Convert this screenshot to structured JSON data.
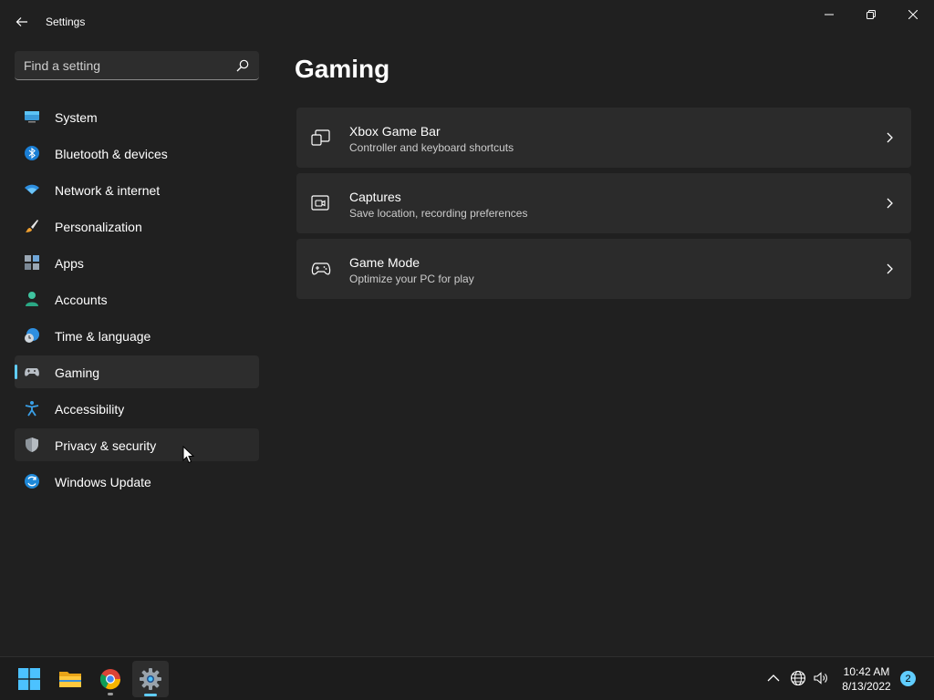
{
  "window": {
    "title": "Settings"
  },
  "search": {
    "placeholder": "Find a setting"
  },
  "sidebar": {
    "items": [
      {
        "label": "System",
        "icon": "monitor-icon"
      },
      {
        "label": "Bluetooth & devices",
        "icon": "bluetooth-icon"
      },
      {
        "label": "Network & internet",
        "icon": "wifi-icon"
      },
      {
        "label": "Personalization",
        "icon": "brush-icon"
      },
      {
        "label": "Apps",
        "icon": "apps-icon"
      },
      {
        "label": "Accounts",
        "icon": "person-icon"
      },
      {
        "label": "Time & language",
        "icon": "clock-globe-icon"
      },
      {
        "label": "Gaming",
        "icon": "gamepad-icon",
        "selected": true
      },
      {
        "label": "Accessibility",
        "icon": "accessibility-icon"
      },
      {
        "label": "Privacy & security",
        "icon": "shield-icon",
        "hovered": true
      },
      {
        "label": "Windows Update",
        "icon": "update-icon"
      }
    ]
  },
  "main": {
    "title": "Gaming",
    "cards": [
      {
        "title": "Xbox Game Bar",
        "subtitle": "Controller and keyboard shortcuts",
        "icon": "game-bar-icon"
      },
      {
        "title": "Captures",
        "subtitle": "Save location, recording preferences",
        "icon": "capture-icon"
      },
      {
        "title": "Game Mode",
        "subtitle": "Optimize your PC for play",
        "icon": "game-mode-icon"
      }
    ]
  },
  "taskbar": {
    "apps": [
      {
        "name": "Start",
        "icon": "windows-start-icon"
      },
      {
        "name": "File Explorer",
        "icon": "folder-icon"
      },
      {
        "name": "Google Chrome",
        "icon": "chrome-icon"
      },
      {
        "name": "Settings",
        "icon": "settings-gear-icon"
      }
    ],
    "time": "10:42 AM",
    "date": "8/13/2022",
    "notification_count": "2"
  },
  "colors": {
    "accent": "#60cdff",
    "background": "#202020",
    "card": "#2b2b2b"
  }
}
